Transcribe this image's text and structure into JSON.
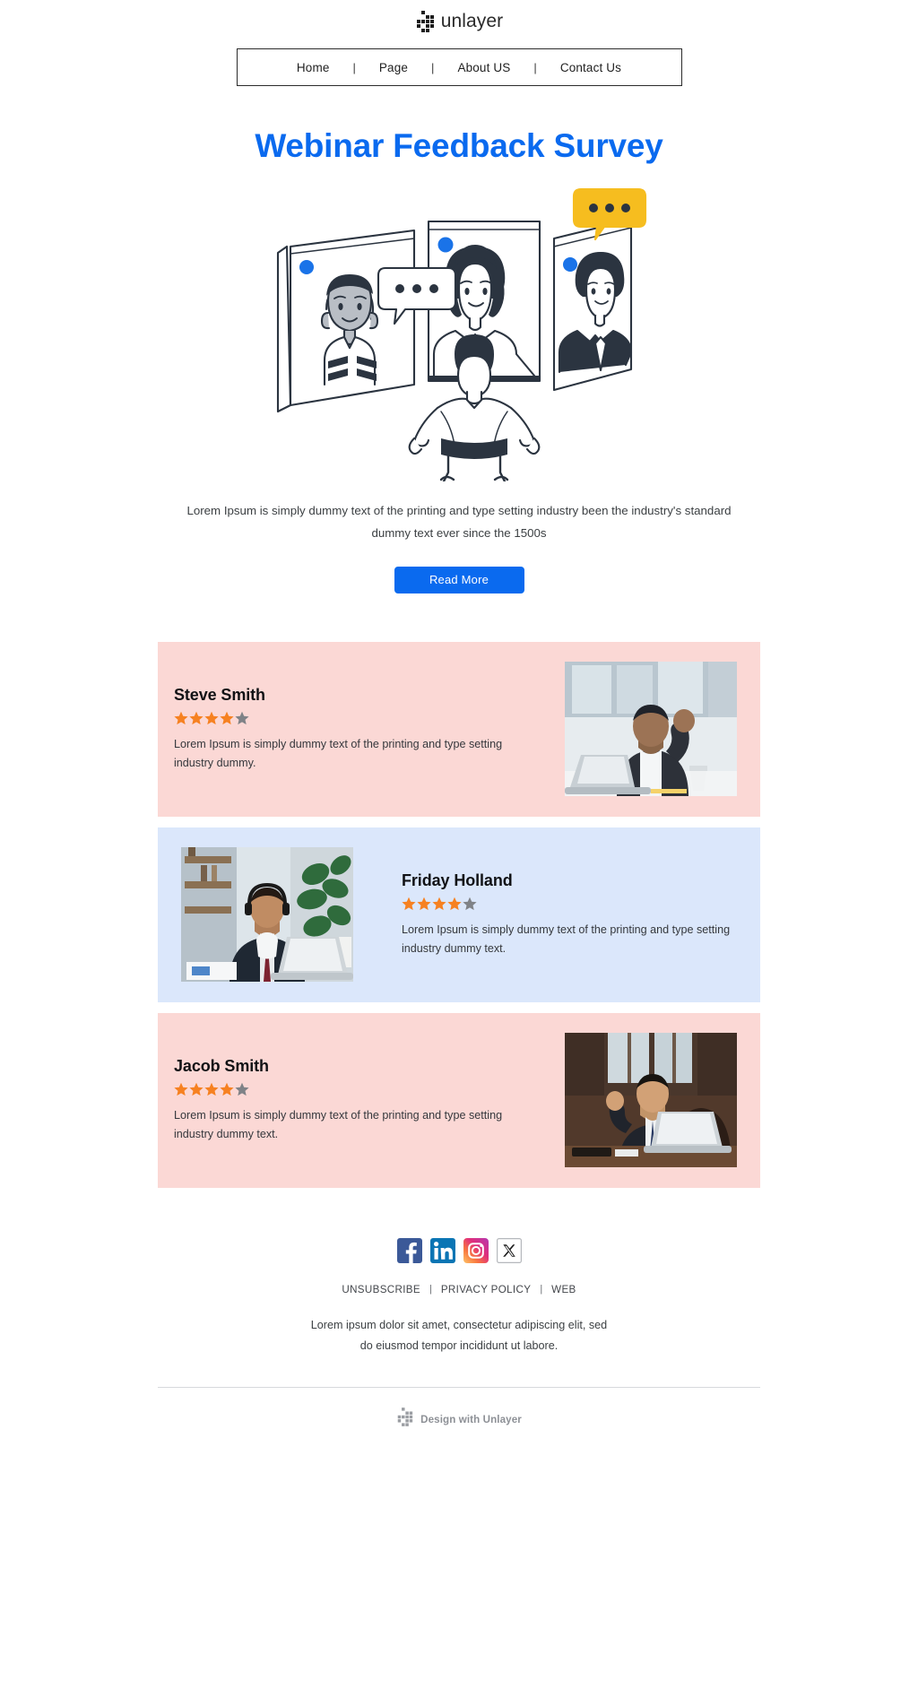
{
  "brand": {
    "logo_icon": "unlayer-pixel-logo",
    "name": "unlayer"
  },
  "nav": {
    "separator": "|",
    "items": [
      {
        "label": "Home"
      },
      {
        "label": "Page"
      },
      {
        "label": "About US"
      },
      {
        "label": "Contact Us"
      }
    ]
  },
  "hero": {
    "title": "Webinar Feedback Survey",
    "illustration_name": "video-conference-illustration",
    "paragraph": "Lorem Ipsum is simply dummy text of the printing and type setting industry been the industry's standard dummy text ever since the 1500s",
    "cta_label": "Read More"
  },
  "colors": {
    "accent_blue": "#0a6aef",
    "card_pink": "#fbd8d5",
    "card_blue": "#dbe7fb",
    "star_filled": "#f68121",
    "star_empty": "#7f8287",
    "heading": "#111215",
    "body_text": "#3c4043"
  },
  "testimonials": [
    {
      "name": "Steve Smith",
      "rating": 4,
      "rating_max": 5,
      "text": "Lorem Ipsum is simply dummy text of the printing and type setting industry dummy.",
      "photo_name": "photo-man-waving-at-laptop",
      "background": "pink",
      "image_side": "right"
    },
    {
      "name": "Friday Holland",
      "rating": 4,
      "rating_max": 5,
      "text": "Lorem Ipsum is simply dummy text of the printing and type setting industry dummy text.",
      "photo_name": "photo-man-with-headset-coffee",
      "background": "blue",
      "image_side": "left"
    },
    {
      "name": "Jacob Smith",
      "rating": 4,
      "rating_max": 5,
      "text": "Lorem Ipsum is simply dummy text of the printing and type setting industry dummy text.",
      "photo_name": "photo-man-at-desk-laptop",
      "background": "pink",
      "image_side": "right"
    }
  ],
  "footer": {
    "social": [
      {
        "name": "facebook-icon",
        "label": "Facebook"
      },
      {
        "name": "linkedin-icon",
        "label": "LinkedIn"
      },
      {
        "name": "instagram-icon",
        "label": "Instagram"
      },
      {
        "name": "x-twitter-icon",
        "label": "X"
      }
    ],
    "separator": "|",
    "links": [
      {
        "label": "UNSUBSCRIBE"
      },
      {
        "label": "PRIVACY POLICY"
      },
      {
        "label": "WEB"
      }
    ],
    "address_line_1": "Lorem ipsum dolor sit amet, consectetur adipiscing elit, sed",
    "address_line_2": "do eiusmod tempor incididunt ut labore.",
    "credit": "Design with Unlayer",
    "credit_icon": "unlayer-pixel-logo-gray"
  }
}
